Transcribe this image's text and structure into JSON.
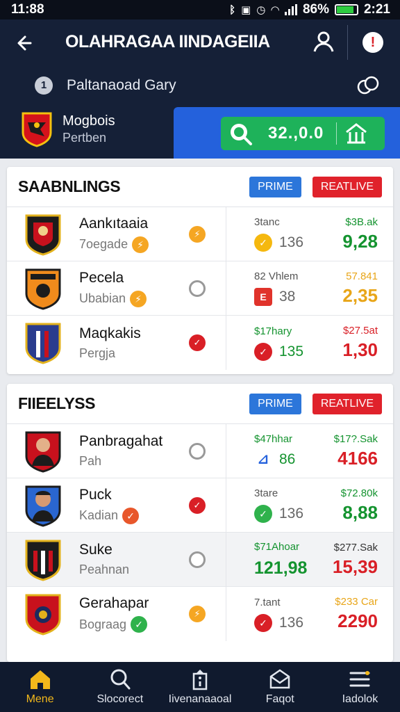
{
  "status_bar": {
    "time": "11:88",
    "battery": "86%",
    "battery_level": 0.86,
    "clock": "2:21"
  },
  "header": {
    "title": "OLAHRAGAA IINDAGEIIA",
    "player_number": "1",
    "player_name": "Paltanaoad Gary",
    "team_name": "Mogbois",
    "team_sub": "Pertben",
    "score_value": "32.,0.0"
  },
  "standings": {
    "title": "SAABNLINGS",
    "tag_prime": "PRIME",
    "tag_live": "REATLIVE",
    "rows": [
      {
        "name": "Aankıtaaia",
        "sub": "7oegade",
        "mid_label": "3tanc",
        "mid_num": "136",
        "right_label": "$3B.ak",
        "right_value": "9,28",
        "right_color": "#14932f"
      },
      {
        "name": "Pecela",
        "sub": "Ubabian",
        "mid_label": "82 Vhlem",
        "mid_num": "38",
        "right_label": "57.841",
        "right_value": "2,35",
        "right_color": "#e8a518"
      },
      {
        "name": "Maqkakis",
        "sub": "Pergja",
        "mid_label": "$17hary",
        "mid_num": "135",
        "right_label": "$27.5at",
        "right_value": "1,30",
        "right_color": "#d91f26"
      }
    ]
  },
  "players": {
    "title": "FIIEELYSS",
    "tag_prime": "PRIME",
    "tag_live": "REATLIVE",
    "rows": [
      {
        "name": "Panbragahat",
        "sub": "Pah",
        "mid_label": "$47hhar",
        "mid_num": "86",
        "right_label": "$17?.Sak",
        "right_value": "4166",
        "right_color": "#d91f26"
      },
      {
        "name": "Puck",
        "sub": "Kadian",
        "mid_label": "3tare",
        "mid_num": "136",
        "right_label": "$72.80k",
        "right_value": "8,88",
        "right_color": "#14932f"
      },
      {
        "name": "Suke",
        "sub": "Peahnan",
        "mid_label": "$71Ahoar",
        "mid_num": "121,98",
        "right_label": "$277.Sak",
        "right_value": "15,39",
        "right_color": "#d91f26"
      },
      {
        "name": "Gerahapar",
        "sub": "Bograag",
        "mid_label": "7.tant",
        "mid_num": "136",
        "right_label": "$233 Car",
        "right_value": "2290",
        "right_color": "#d91f26"
      }
    ]
  },
  "nav": {
    "items": [
      {
        "label": "Mene",
        "icon": "home-icon"
      },
      {
        "label": "Slocorect",
        "icon": "search-icon"
      },
      {
        "label": "Iivenanaaoal",
        "icon": "info-icon"
      },
      {
        "label": "Faqot",
        "icon": "mail-icon"
      },
      {
        "label": "Iadolok",
        "icon": "menu-icon"
      }
    ]
  },
  "colors": {
    "header_bg": "#152037",
    "blue_panel": "#2461dc",
    "green_pill": "#1eb25a",
    "tag_blue": "#2c76da",
    "tag_red": "#e0222b",
    "nav_active": "#f2b81b"
  }
}
